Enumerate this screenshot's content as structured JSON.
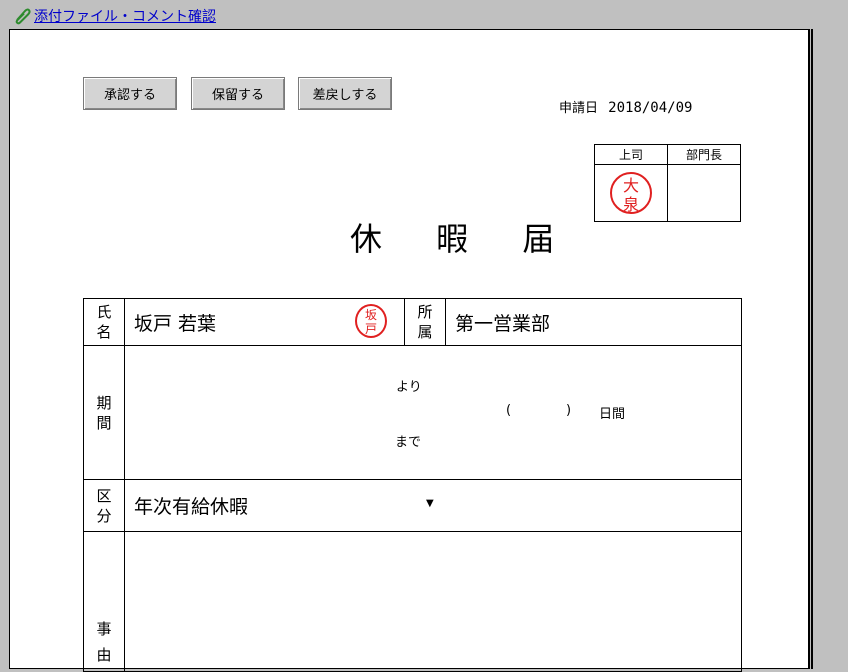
{
  "header": {
    "attach_link": "添付ファイル・コメント確認"
  },
  "actions": {
    "approve": "承認する",
    "hold": "保留する",
    "return": "差戻しする"
  },
  "application": {
    "date_label": "申請日",
    "date": "2018/04/09"
  },
  "approval": {
    "col1": "上司",
    "col2": "部門長",
    "seal1_top": "大",
    "seal1_bottom": "泉"
  },
  "form": {
    "title": "休 暇 届",
    "name_label_1": "氏",
    "name_label_2": "名",
    "name_value": "坂戸  若葉",
    "name_seal_top": "坂",
    "name_seal_bottom": "戸",
    "dept_label_1": "所",
    "dept_label_2": "属",
    "dept_value": "第一営業部",
    "period_label_1": "期",
    "period_label_2": "間",
    "from_text": "より",
    "to_text": "まで",
    "days_open": "(",
    "days_close": ")",
    "days_unit": "日間",
    "type_label_1": "区",
    "type_label_2": "分",
    "type_value": "年次有給休暇",
    "reason_label_1": "事",
    "reason_label_2": "由"
  },
  "colors": {
    "seal_red": "#e02020",
    "link_blue": "#0000cc",
    "background": "#c0c0c0"
  },
  "icons": {
    "attach": "paperclip-icon",
    "dropdown": "dropdown-arrow-icon"
  }
}
